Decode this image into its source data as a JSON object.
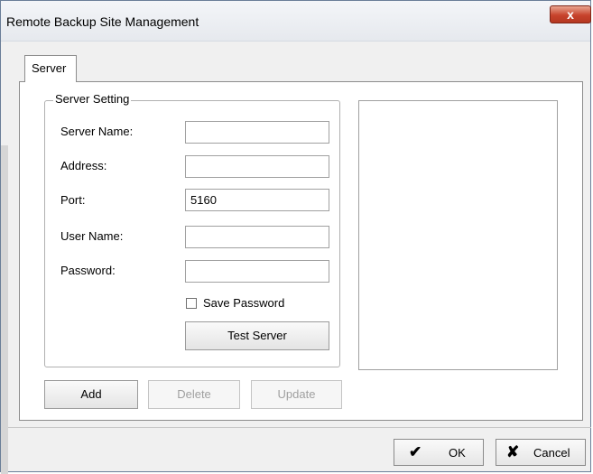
{
  "window": {
    "title": "Remote Backup Site Management",
    "close_glyph": "x"
  },
  "tabs": [
    {
      "label": "Server",
      "selected": true
    }
  ],
  "server_setting": {
    "legend": "Server Setting",
    "fields": {
      "server_name": {
        "label": "Server Name:",
        "value": ""
      },
      "address": {
        "label": "Address:",
        "value": ""
      },
      "port": {
        "label": "Port:",
        "value": "5160"
      },
      "user_name": {
        "label": "User Name:",
        "value": ""
      },
      "password": {
        "label": "Password:",
        "value": ""
      }
    },
    "save_password": {
      "label": "Save Password",
      "checked": false
    },
    "test_server_label": "Test Server"
  },
  "actions": {
    "add_label": "Add",
    "delete_label": "Delete",
    "update_label": "Update"
  },
  "footer": {
    "ok_label": "OK",
    "ok_icon": "check-icon",
    "cancel_label": "Cancel",
    "cancel_icon": "x-mark-icon"
  },
  "colors": {
    "close_button": "#c7432c",
    "window_bg": "#f0f0f0",
    "panel_bg": "#ffffff"
  }
}
